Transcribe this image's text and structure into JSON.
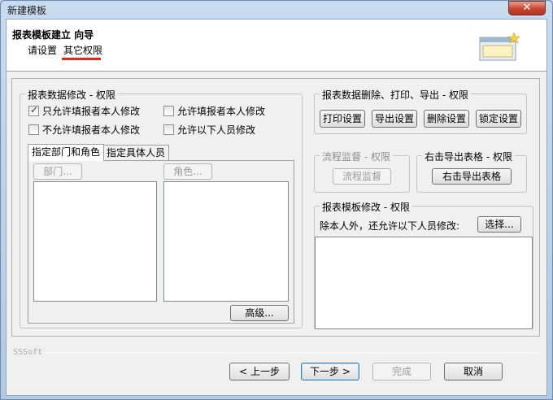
{
  "window": {
    "title": "新建模板",
    "close_glyph": "✕"
  },
  "wizard": {
    "title": "报表模板建立 向导",
    "steps": [
      "请设置",
      "其它权限"
    ],
    "active_step": "其它权限",
    "icon": "wizard-window-icon"
  },
  "data_edit": {
    "label": "报表数据修改 - 权限",
    "options": [
      {
        "label": "只允许填报者本人修改",
        "checked": true
      },
      {
        "label": "允许填报者本人修改",
        "checked": false
      },
      {
        "label": "不允许填报者本人修改",
        "checked": false
      },
      {
        "label": "允许以下人员修改",
        "checked": false
      }
    ],
    "tabs": [
      "指定部门和角色",
      "指定具体人员"
    ],
    "dept_button": "部门...",
    "role_button": "角色...",
    "advanced_button": "高级..."
  },
  "delete_print": {
    "label": "报表数据删除、打印、导出 - 权限",
    "buttons": [
      "打印设置",
      "导出设置",
      "删除设置",
      "锁定设置"
    ]
  },
  "flow": {
    "label": "流程监督 - 权限",
    "button": "流程监督"
  },
  "rightclick": {
    "label": "右击导出表格 - 权限",
    "button": "右击导出表格"
  },
  "template_edit": {
    "label": "报表模板修改 - 权限",
    "hint": "除本人外，还允许以下人员修改:",
    "choose_button": "选择..."
  },
  "footer": {
    "brand": "SSSoft",
    "prev": "上一步",
    "next": "下一步",
    "finish": "完成",
    "cancel": "取消",
    "prev_glyph": "<",
    "next_glyph": ">"
  }
}
